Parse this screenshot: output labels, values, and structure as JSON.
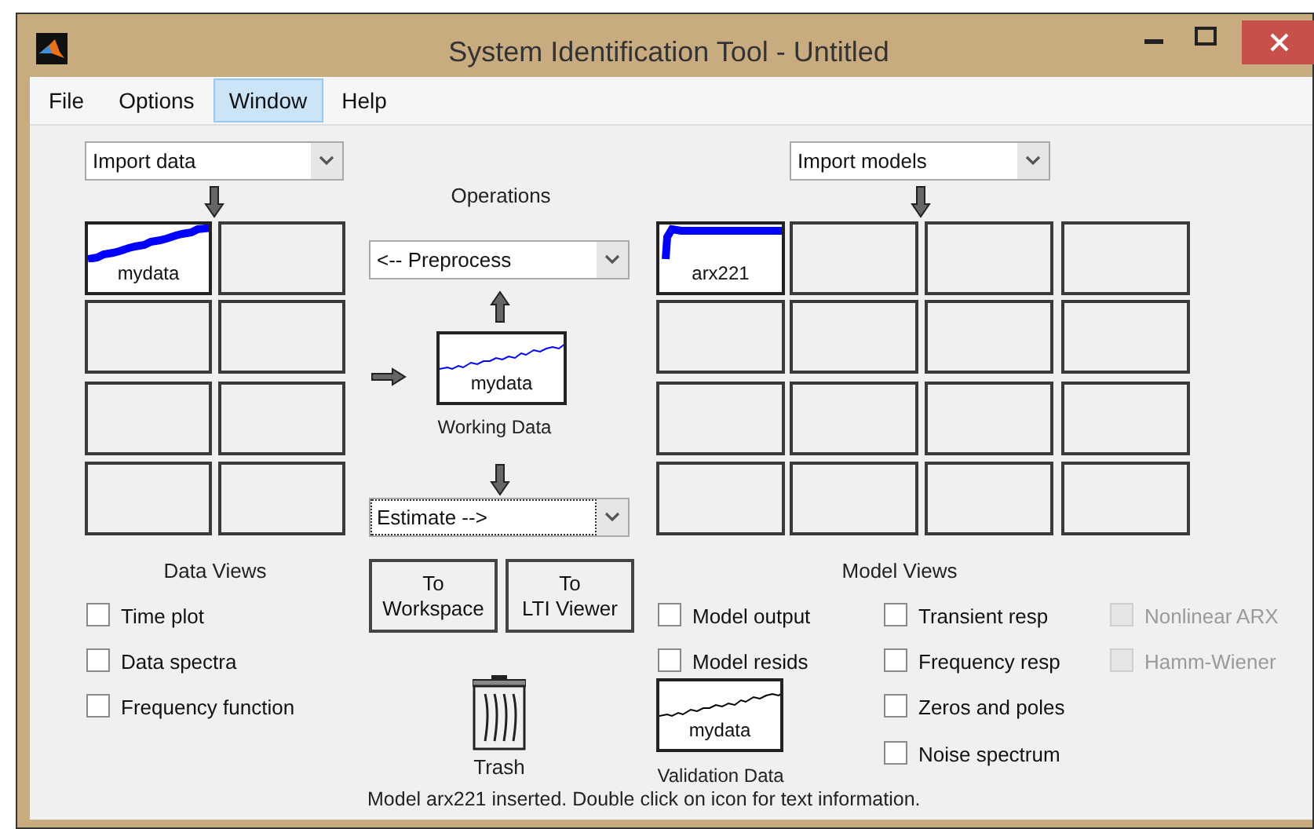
{
  "window": {
    "title": "System Identification Tool - Untitled"
  },
  "menu": [
    {
      "label": "File",
      "selected": false
    },
    {
      "label": "Options",
      "selected": false
    },
    {
      "label": "Window",
      "selected": true
    },
    {
      "label": "Help",
      "selected": false
    }
  ],
  "data_import": {
    "value": "Import data"
  },
  "data_slots": [
    {
      "kind": "data",
      "label": "mydata"
    },
    {
      "kind": "empty"
    },
    {
      "kind": "empty"
    },
    {
      "kind": "empty"
    },
    {
      "kind": "empty"
    },
    {
      "kind": "empty"
    },
    {
      "kind": "empty"
    },
    {
      "kind": "empty"
    }
  ],
  "operations": {
    "title": "Operations",
    "preprocess": {
      "value": "<-- Preprocess",
      "focused": false
    },
    "working_data": {
      "label": "mydata",
      "caption": "Working Data"
    },
    "estimate": {
      "value": "Estimate -->",
      "focused": true
    }
  },
  "buttons": [
    {
      "lines": [
        "To",
        "Workspace"
      ]
    },
    {
      "lines": [
        "To",
        "LTI Viewer"
      ]
    }
  ],
  "trash": {
    "label": "Trash"
  },
  "data_views": {
    "title": "Data Views",
    "options": [
      {
        "label": "Time plot",
        "checked": false
      },
      {
        "label": "Data spectra",
        "checked": false
      },
      {
        "label": "Frequency function",
        "checked": false
      }
    ]
  },
  "model_import": {
    "value": "Import models"
  },
  "model_slots": [
    {
      "kind": "model",
      "label": "arx221"
    },
    {
      "kind": "empty"
    },
    {
      "kind": "empty"
    },
    {
      "kind": "empty"
    },
    {
      "kind": "empty"
    },
    {
      "kind": "empty"
    },
    {
      "kind": "empty"
    },
    {
      "kind": "empty"
    },
    {
      "kind": "empty"
    },
    {
      "kind": "empty"
    },
    {
      "kind": "empty"
    },
    {
      "kind": "empty"
    },
    {
      "kind": "empty"
    },
    {
      "kind": "empty"
    },
    {
      "kind": "empty"
    },
    {
      "kind": "empty"
    }
  ],
  "validation_data": {
    "label": "mydata",
    "caption": "Validation Data"
  },
  "model_views": {
    "title": "Model Views",
    "options": [
      {
        "label": "Model output",
        "checked": false,
        "disabled": false
      },
      {
        "label": "Model resids",
        "checked": false,
        "disabled": false
      },
      {
        "label": "Transient resp",
        "checked": false,
        "disabled": false
      },
      {
        "label": "Frequency resp",
        "checked": false,
        "disabled": false
      },
      {
        "label": "Zeros and poles",
        "checked": false,
        "disabled": false
      },
      {
        "label": "Noise spectrum",
        "checked": false,
        "disabled": false
      },
      {
        "label": "Nonlinear ARX",
        "checked": false,
        "disabled": true
      },
      {
        "label": "Hamm-Wiener",
        "checked": false,
        "disabled": true
      }
    ]
  },
  "status_bar": "Model arx221 inserted. Double click on icon for text information."
}
